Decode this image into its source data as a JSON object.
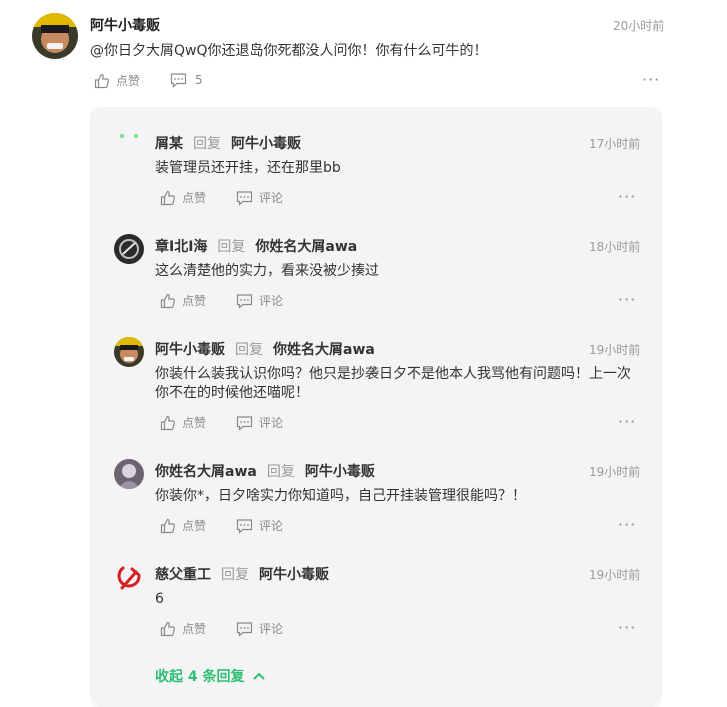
{
  "main_comment": {
    "author": "阿牛小毒贩",
    "time": "20小时前",
    "text": "@你日夕大屑QwQ你还退岛你死都没人问你！你有什么可牛的！",
    "like_label": "点赞",
    "reply_count": "5"
  },
  "replies": [
    {
      "author": "屑某",
      "reply_word": "回复",
      "target": "阿牛小毒贩",
      "time": "17小时前",
      "text": "装管理员还开挂，还在那里bb",
      "like_label": "点赞",
      "comment_label": "评论"
    },
    {
      "author": "章I北I海",
      "reply_word": "回复",
      "target": "你姓名大屑awa",
      "time": "18小时前",
      "text": "这么清楚他的实力，看来没被少揍过",
      "like_label": "点赞",
      "comment_label": "评论"
    },
    {
      "author": "阿牛小毒贩",
      "reply_word": "回复",
      "target": "你姓名大屑awa",
      "time": "19小时前",
      "text_line1": "你装什么装我认识你吗？他只是抄袭日夕不是他本人我骂他有问题吗！上一次",
      "text_line2": "你不在的时候他还喵呢！",
      "like_label": "点赞",
      "comment_label": "评论"
    },
    {
      "author": "你姓名大屑awa",
      "reply_word": "回复",
      "target": "阿牛小毒贩",
      "time": "19小时前",
      "text": "你装你*，日夕啥实力你知道吗，自己开挂装管理很能吗？！",
      "like_label": "点赞",
      "comment_label": "评论"
    },
    {
      "author": "慈父重工",
      "reply_word": "回复",
      "target": "阿牛小毒贩",
      "time": "19小时前",
      "text": "6",
      "like_label": "点赞",
      "comment_label": "评论"
    }
  ],
  "collapse_label": "收起 4 条回复",
  "more_label": "···",
  "colors": {
    "accent": "#2cbf76",
    "panel": "#f4f4f4",
    "muted": "#8a8a8a"
  }
}
